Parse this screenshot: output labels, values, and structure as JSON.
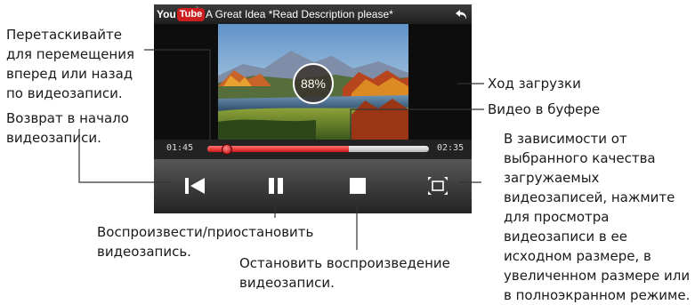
{
  "player": {
    "brand_you": "You",
    "brand_tube": "Tube",
    "video_title": "A Great Idea *Read Description please*",
    "loading_percent": "88%",
    "time_elapsed": "01:45",
    "time_total": "02:35",
    "playback_fraction": 0.09,
    "buffer_fraction": 0.64
  },
  "callouts": {
    "drag_seek": "Перетаскивайте\nдля перемещения\nвперед или назад\nпо видеозаписи.",
    "rewind": "Возврат в начало\nвидеозаписи.",
    "download_progress": "Ход загрузки",
    "buffered": "Видео в буфере",
    "size_mode": "В зависимости от\nвыбранного качества\nзагружаемых\nвидеозаписей, нажмите\nдля просмотра\nвидеозаписи в ее\nисходном размере, в\nувеличенном размере или\nв полноэкранном режиме.",
    "play_pause": "Воспроизвести/приостановить\nвидеозапись.",
    "stop": "Остановить воспроизведение\nвидеозаписи."
  },
  "icons": {
    "back": "back-arrow-icon",
    "rewind": "skip-to-start-icon",
    "pause": "pause-icon",
    "stop": "stop-icon",
    "size": "fullscreen-icon"
  },
  "colors": {
    "progress_red": "#d01818",
    "yt_red": "#cc1e1e",
    "screen_bg": "#191919",
    "leader_line": "#333333"
  }
}
